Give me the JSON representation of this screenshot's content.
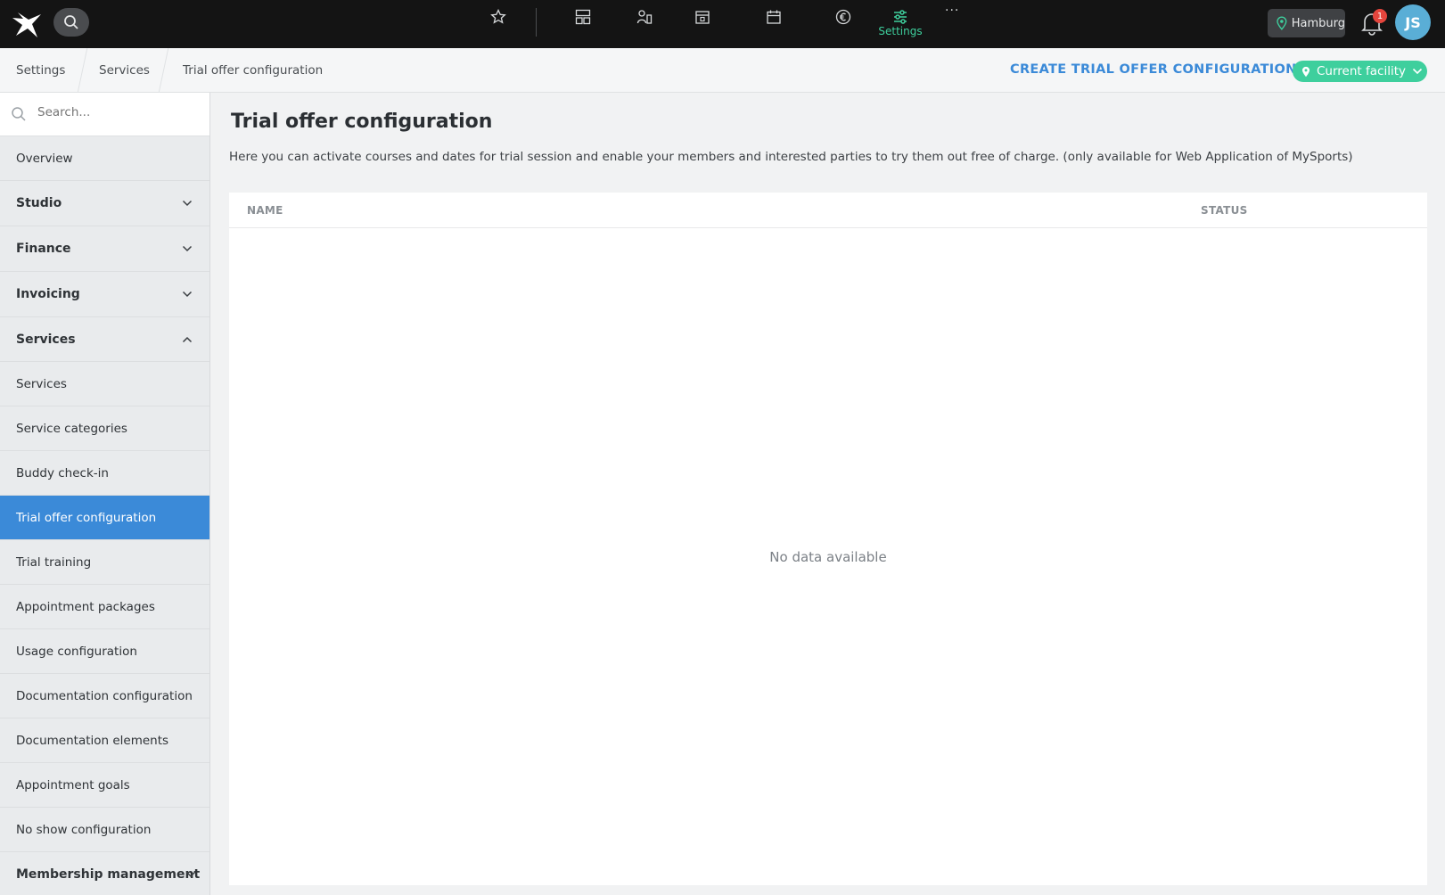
{
  "topbar": {
    "search_label": "search",
    "nav_icons": [
      "star-icon",
      "dashboard-icon",
      "members-icon",
      "checkin-icon",
      "calendar-icon",
      "euro-icon",
      "settings-sliders-icon"
    ],
    "active_label": "Settings",
    "more_label": "···",
    "location": "Hamburg",
    "notification_count": "1",
    "avatar_initials": "JS"
  },
  "breadcrumb": {
    "items": [
      "Settings",
      "Services",
      "Trial offer configuration"
    ]
  },
  "actions": {
    "create_label": "CREATE TRIAL OFFER CONFIGURATION",
    "facility_label": "Current facility"
  },
  "sidebar": {
    "search_placeholder": "Search...",
    "items": [
      {
        "label": "Overview",
        "type": "item"
      },
      {
        "label": "Studio",
        "type": "group",
        "expanded": false
      },
      {
        "label": "Finance",
        "type": "group",
        "expanded": false
      },
      {
        "label": "Invoicing",
        "type": "group",
        "expanded": false
      },
      {
        "label": "Services",
        "type": "group",
        "expanded": true
      },
      {
        "label": "Services",
        "type": "item"
      },
      {
        "label": "Service categories",
        "type": "item"
      },
      {
        "label": "Buddy check-in",
        "type": "item"
      },
      {
        "label": "Trial offer configuration",
        "type": "item",
        "active": true
      },
      {
        "label": "Trial training",
        "type": "item"
      },
      {
        "label": "Appointment packages",
        "type": "item"
      },
      {
        "label": "Usage configuration",
        "type": "item"
      },
      {
        "label": "Documentation configuration",
        "type": "item"
      },
      {
        "label": "Documentation elements",
        "type": "item"
      },
      {
        "label": "Appointment goals",
        "type": "item"
      },
      {
        "label": "No show configuration",
        "type": "item"
      },
      {
        "label": "Membership management",
        "type": "group",
        "expanded": false
      }
    ]
  },
  "main": {
    "title": "Trial offer configuration",
    "description": "Here you can activate courses and dates for trial session and enable your members and interested parties to try them out free of charge. (only available for Web Application of MySports)",
    "table": {
      "columns": [
        "NAME",
        "STATUS"
      ],
      "empty_text": "No data available"
    }
  },
  "colors": {
    "accent_blue": "#3b8ad8",
    "accent_green": "#3ecf9d",
    "topbar_bg": "#141414"
  }
}
